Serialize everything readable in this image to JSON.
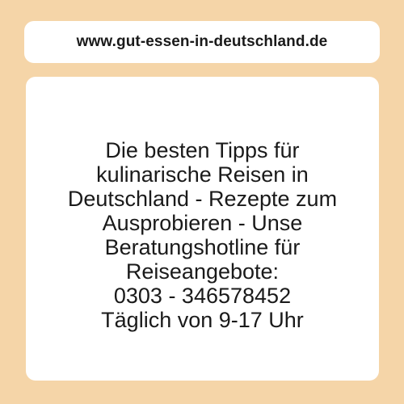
{
  "header": {
    "url": "www.gut-essen-in-deutschland.de"
  },
  "main": {
    "text": "Die besten Tipps für\nkulinarische Reisen in\nDeutschland - Rezepte zum\nAusprobieren - Unse\nBeratungshotline für\nReiseangebote:\n0303 - 346578452\nTäglich von 9-17 Uhr"
  },
  "colors": {
    "background": "#f5d5a8",
    "card": "#ffffff",
    "text": "#1a1a1a"
  }
}
